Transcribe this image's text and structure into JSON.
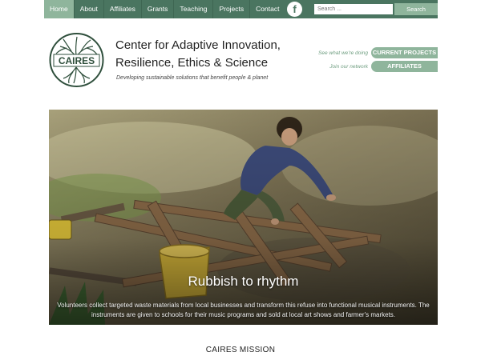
{
  "nav": {
    "items": [
      "Home",
      "About",
      "Affiliates",
      "Grants",
      "Teaching",
      "Projects",
      "Contact"
    ],
    "active": "Home",
    "facebook_glyph": "f",
    "search_placeholder": "Search ...",
    "search_button": "Search"
  },
  "header": {
    "logo_text": "CAIRES",
    "title_line1": "Center for Adaptive Innovation,",
    "title_line2": "Resilience, Ethics & Science",
    "tagline": "Developing sustainable solutions that benefit people & planet",
    "projects_note": "See what we're doing",
    "projects_button": "CURRENT PROJECTS",
    "affiliates_note": "Join our network",
    "affiliates_button": "AFFILIATES"
  },
  "hero": {
    "title": "Rubbish to rhythm",
    "caption": "Volunteers collect targeted waste materials from local businesses and transform this refuse into functional musical instruments. The instruments are given to schools for their music programs and sold at local art shows and farmer's markets."
  },
  "mission": {
    "title": "CAIRES MISSION"
  },
  "colors": {
    "nav_bg": "#4a7560",
    "accent": "#8fb59c"
  }
}
